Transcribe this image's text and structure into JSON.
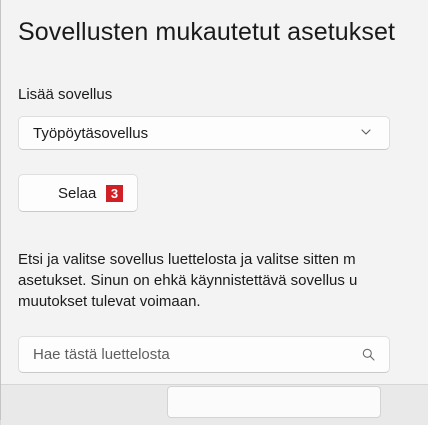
{
  "dialog": {
    "title": "Sovellusten mukautetut asetukset",
    "add_app_label": "Lisää sovellus",
    "app_type_select": {
      "selected": "Työpöytäsovellus",
      "icon": "chevron-down-icon"
    },
    "browse_button": {
      "label": "Selaa",
      "badge": "3",
      "badge_color": "#d11f26"
    },
    "description_lines": [
      "Etsi ja valitse sovellus luettelosta ja valitse sitten m",
      "asetukset. Sinun on ehkä käynnistettävä sovellus u",
      "muutokset tulevat voimaan."
    ],
    "search": {
      "placeholder": "Hae tästä luettelosta",
      "value": "",
      "icon": "search-icon"
    }
  }
}
